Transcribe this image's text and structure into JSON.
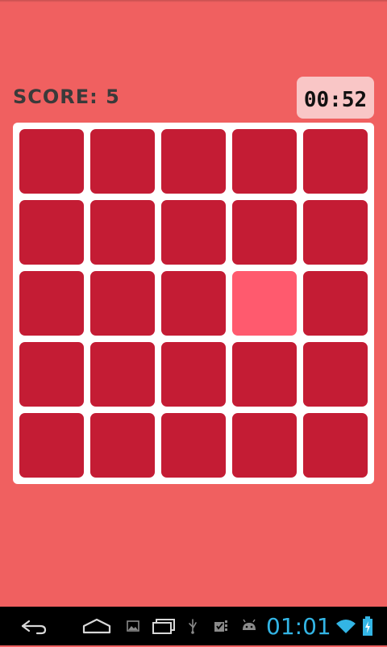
{
  "colors": {
    "background": "#f06060",
    "board": "#ffffff",
    "tile": "#c41c34",
    "tile_highlight": "#ff5a6e",
    "timer_bg": "#f9c6c6",
    "navbar": "#000000",
    "clock": "#33b5e5"
  },
  "header": {
    "score_text": "SCORE: 5",
    "timer_text": "00:52"
  },
  "board": {
    "rows": 5,
    "cols": 5,
    "tiles": [
      [
        0,
        0,
        0,
        0,
        0
      ],
      [
        0,
        0,
        0,
        0,
        0
      ],
      [
        0,
        0,
        0,
        1,
        0
      ],
      [
        0,
        0,
        0,
        0,
        0
      ],
      [
        0,
        0,
        0,
        0,
        0
      ]
    ]
  },
  "navbar": {
    "icons": [
      "back-icon",
      "home-icon",
      "recent-apps-icon"
    ],
    "notification_icons": [
      "gallery-icon",
      "screenshot-icon",
      "usb-icon",
      "task-icon",
      "android-icon"
    ],
    "clock": "01:01",
    "status_icons": [
      "wifi-icon",
      "battery-icon"
    ]
  }
}
